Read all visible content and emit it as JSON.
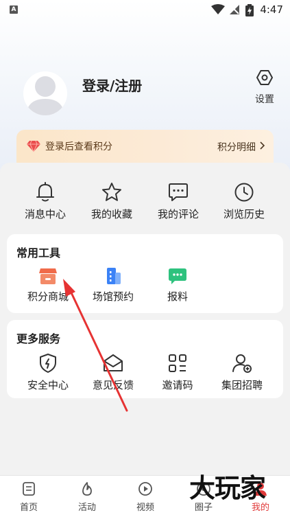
{
  "status_bar": {
    "time": "4:47",
    "left_icon_text": "A"
  },
  "profile": {
    "login_label": "登录/注册",
    "settings_label": "设置"
  },
  "points_banner": {
    "text": "登录后查看积分",
    "detail_link": "积分明细"
  },
  "quick_actions": [
    {
      "label": "消息中心",
      "icon": "bell-icon"
    },
    {
      "label": "我的收藏",
      "icon": "star-icon"
    },
    {
      "label": "我的评论",
      "icon": "comment-icon"
    },
    {
      "label": "浏览历史",
      "icon": "clock-icon"
    }
  ],
  "common_tools": {
    "title": "常用工具",
    "items": [
      {
        "label": "积分商城",
        "icon": "shop-icon",
        "color": "#f06b4a"
      },
      {
        "label": "场馆预约",
        "icon": "building-icon",
        "color": "#3b82f6"
      },
      {
        "label": "报料",
        "icon": "message-icon",
        "color": "#2ec27e"
      }
    ]
  },
  "more_services": {
    "title": "更多服务",
    "items": [
      {
        "label": "安全中心",
        "icon": "shield-icon"
      },
      {
        "label": "意见反馈",
        "icon": "envelope-icon"
      },
      {
        "label": "邀请码",
        "icon": "qr-icon"
      },
      {
        "label": "集团招聘",
        "icon": "user-add-icon"
      }
    ]
  },
  "bottom_nav": [
    {
      "label": "首页",
      "icon": "home-icon"
    },
    {
      "label": "活动",
      "icon": "flame-icon"
    },
    {
      "label": "视频",
      "icon": "play-icon"
    },
    {
      "label": "圈子",
      "icon": "circle-icon"
    },
    {
      "label": "我的",
      "icon": "profile-icon",
      "active": true
    }
  ],
  "watermark": "大玩家",
  "colors": {
    "accent_red": "#e03a3a",
    "banner_text": "#5b3a1a"
  }
}
